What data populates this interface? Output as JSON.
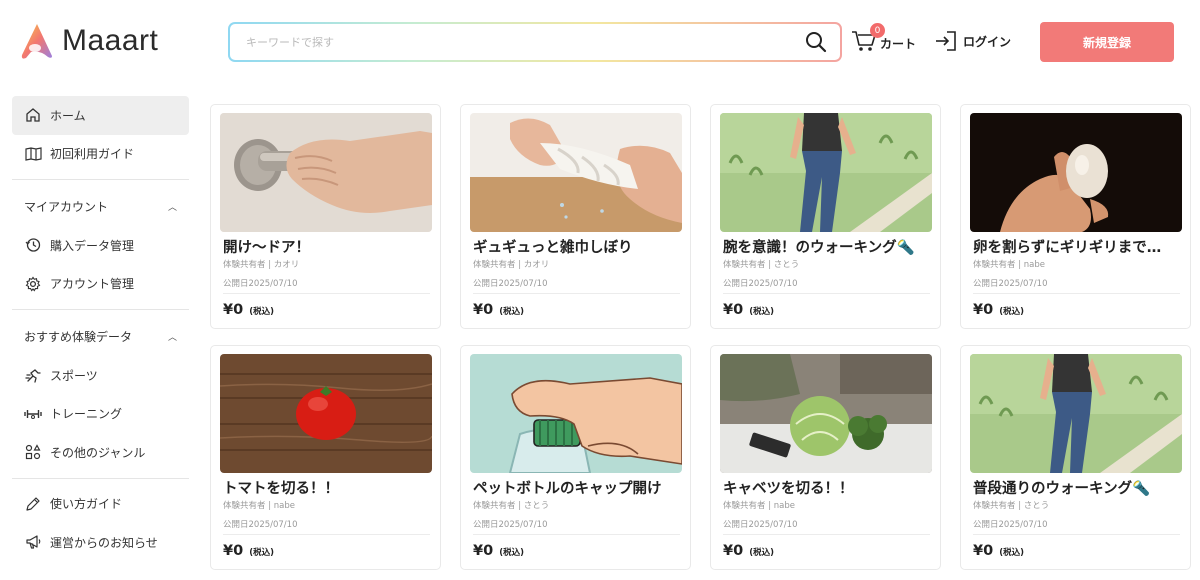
{
  "header": {
    "logo_text": "Maaart",
    "search_placeholder": "キーワードで探す",
    "cart_label": "カート",
    "cart_count": "0",
    "login_label": "ログイン",
    "register_label": "新規登録"
  },
  "sidebar": {
    "home": "ホーム",
    "guide_first": "初回利用ガイド",
    "my_account": "マイアカウント",
    "purchase_data": "購入データ管理",
    "account_manage": "アカウント管理",
    "recommend": "おすすめ体験データ",
    "sports": "スポーツ",
    "training": "トレーニング",
    "other_genre": "その他のジャンル",
    "how_to_guide": "使い方ガイド",
    "notice": "運営からのお知らせ"
  },
  "colors": {
    "accent": "#f27a78",
    "badge": "#f26b6b"
  },
  "cards": [
    {
      "title": "開け〜ドア！",
      "author": "体験共有者 | カオリ",
      "date": "公開日2025/07/10",
      "price": "¥0",
      "tax": "(税込)",
      "image": "hand-on-door-handle"
    },
    {
      "title": "ギュギュっと雑巾しぼり",
      "author": "体験共有者 | カオリ",
      "date": "公開日2025/07/10",
      "price": "¥0",
      "tax": "(税込)",
      "image": "wringing-towel"
    },
    {
      "title": "腕を意識！のウォーキング🔦",
      "author": "体験共有者 | さとう",
      "date": "公開日2025/07/10",
      "price": "¥0",
      "tax": "(税込)",
      "image": "walking-illustration"
    },
    {
      "title": "卵を割らずにギリギリまで…",
      "author": "体験共有者 | nabe",
      "date": "公開日2025/07/10",
      "price": "¥0",
      "tax": "(税込)",
      "image": "hand-holding-egg"
    },
    {
      "title": "トマトを切る！！",
      "author": "体験共有者 | nabe",
      "date": "公開日2025/07/10",
      "price": "¥0",
      "tax": "(税込)",
      "image": "tomato-on-board"
    },
    {
      "title": "ペットボトルのキャップ開け",
      "author": "体験共有者 | さとう",
      "date": "公開日2025/07/10",
      "price": "¥0",
      "tax": "(税込)",
      "image": "bottle-cap-illustration"
    },
    {
      "title": "キャベツを切る！！",
      "author": "体験共有者 | nabe",
      "date": "公開日2025/07/10",
      "price": "¥0",
      "tax": "(税込)",
      "image": "cabbage-broccoli"
    },
    {
      "title": "普段通りのウォーキング🔦",
      "author": "体験共有者 | さとう",
      "date": "公開日2025/07/10",
      "price": "¥0",
      "tax": "(税込)",
      "image": "walking-illustration"
    }
  ]
}
